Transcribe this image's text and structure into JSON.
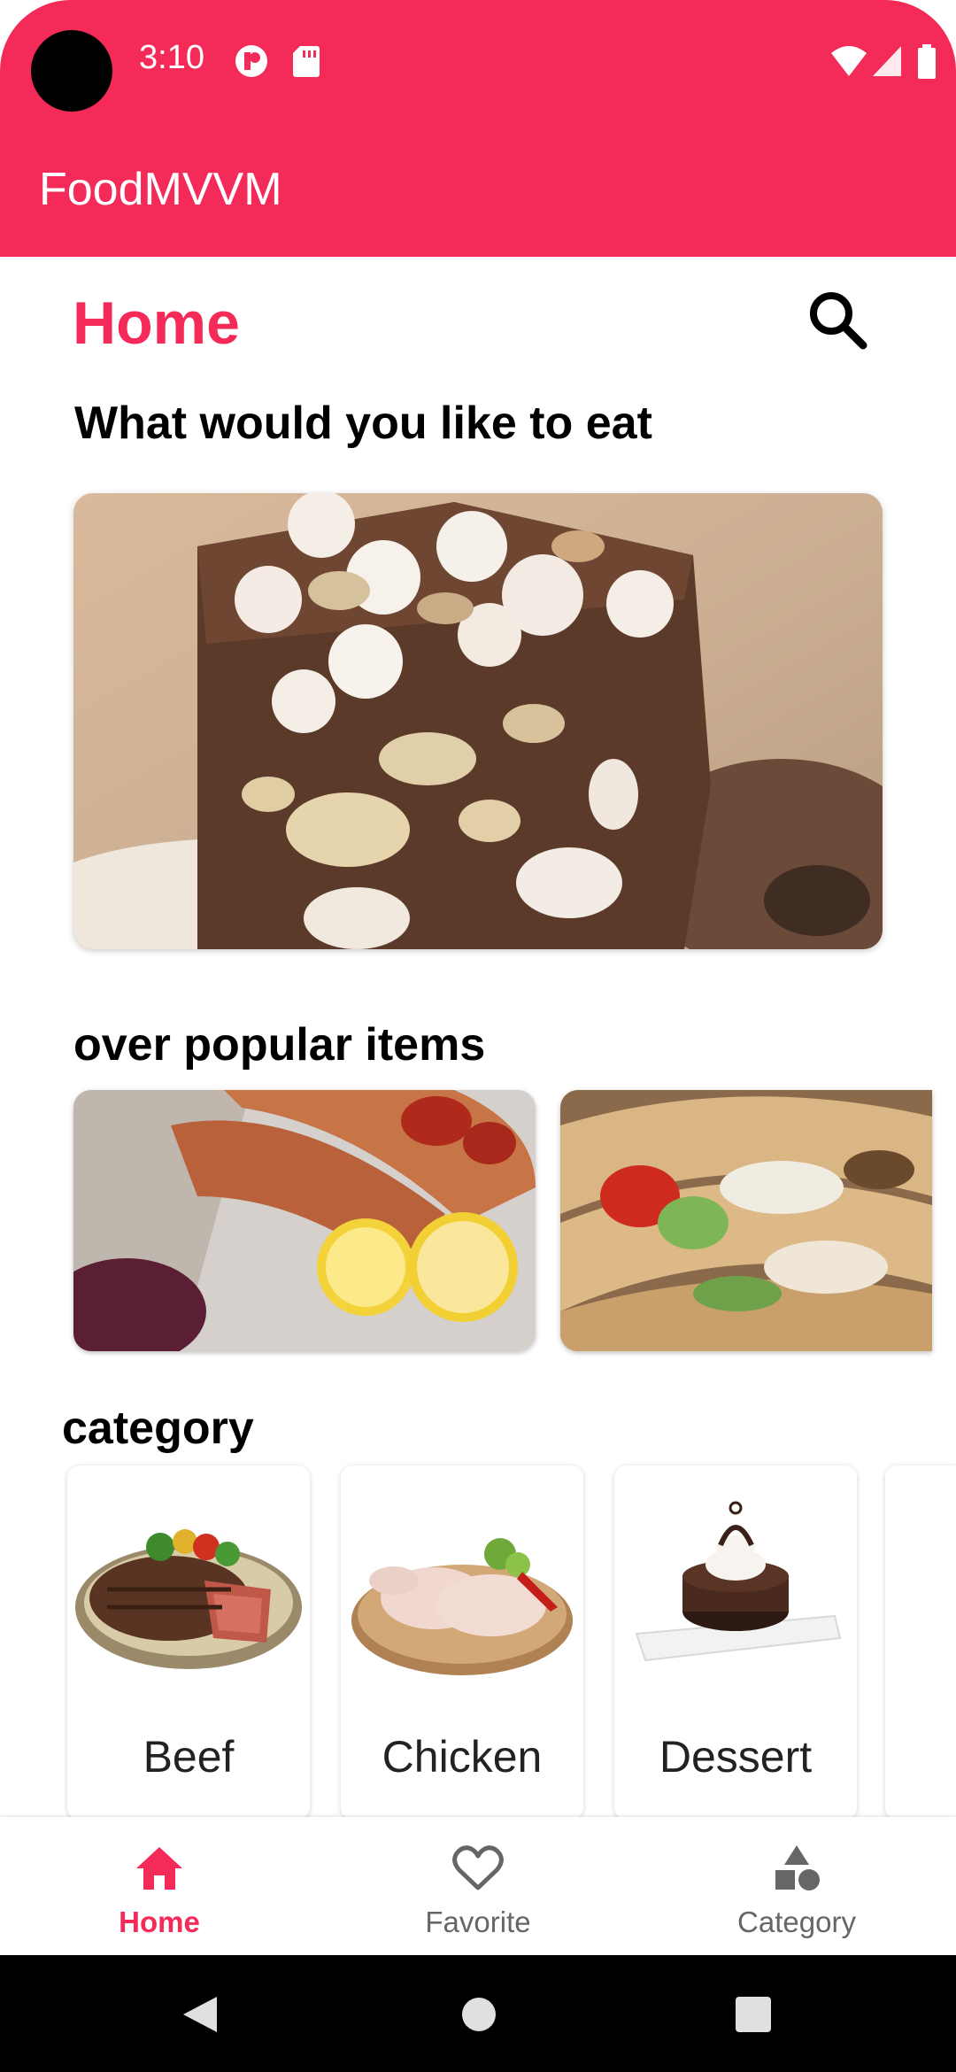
{
  "status_bar": {
    "time": "3:10",
    "color": "#F42A58"
  },
  "app_bar": {
    "title": "FoodMVVM"
  },
  "page": {
    "title": "Home",
    "prompt": "What would you like to eat",
    "accent": "#F42A58"
  },
  "popular": {
    "title": "over popular items"
  },
  "category": {
    "title": "category",
    "items": [
      {
        "label": "Beef",
        "icon": "beef-steak-image"
      },
      {
        "label": "Chicken",
        "icon": "chicken-image"
      },
      {
        "label": "Dessert",
        "icon": "dessert-image"
      }
    ]
  },
  "bottom_nav": {
    "items": [
      {
        "label": "Home",
        "icon": "home-icon",
        "active": true
      },
      {
        "label": "Favorite",
        "icon": "heart-icon",
        "active": false
      },
      {
        "label": "Category",
        "icon": "shapes-icon",
        "active": false
      }
    ]
  }
}
